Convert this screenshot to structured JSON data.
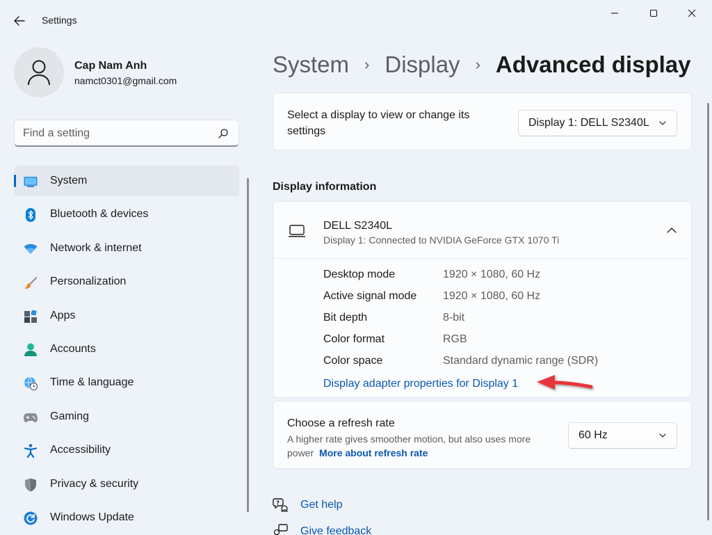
{
  "window": {
    "title": "Settings"
  },
  "profile": {
    "name": "Cap Nam Anh",
    "email": "namct0301@gmail.com"
  },
  "search": {
    "placeholder": "Find a setting",
    "value": ""
  },
  "sidebar": {
    "items": [
      {
        "label": "System",
        "icon": "system-icon",
        "active": true
      },
      {
        "label": "Bluetooth & devices",
        "icon": "bluetooth-icon"
      },
      {
        "label": "Network & internet",
        "icon": "wifi-icon"
      },
      {
        "label": "Personalization",
        "icon": "brush-icon"
      },
      {
        "label": "Apps",
        "icon": "apps-icon"
      },
      {
        "label": "Accounts",
        "icon": "accounts-icon"
      },
      {
        "label": "Time & language",
        "icon": "globe-clock-icon"
      },
      {
        "label": "Gaming",
        "icon": "gamepad-icon"
      },
      {
        "label": "Accessibility",
        "icon": "accessibility-icon"
      },
      {
        "label": "Privacy & security",
        "icon": "shield-icon"
      },
      {
        "label": "Windows Update",
        "icon": "update-icon"
      }
    ]
  },
  "breadcrumb": {
    "items": [
      "System",
      "Display"
    ],
    "current": "Advanced display",
    "separator": "›"
  },
  "display_select": {
    "label": "Select a display to view or change its settings",
    "selected": "Display 1: DELL S2340L"
  },
  "display_info": {
    "section_title": "Display information",
    "device_name": "DELL S2340L",
    "device_sub": "Display 1: Connected to NVIDIA GeForce GTX 1070 Ti",
    "rows": [
      {
        "key": "Desktop mode",
        "value": "1920 × 1080, 60 Hz"
      },
      {
        "key": "Active signal mode",
        "value": "1920 × 1080, 60 Hz"
      },
      {
        "key": "Bit depth",
        "value": "8-bit"
      },
      {
        "key": "Color format",
        "value": "RGB"
      },
      {
        "key": "Color space",
        "value": "Standard dynamic range (SDR)"
      }
    ],
    "adapter_link": "Display adapter properties for Display 1"
  },
  "refresh_rate": {
    "title": "Choose a refresh rate",
    "description": "A higher rate gives smoother motion, but also uses more power",
    "link": "More about refresh rate",
    "selected": "60 Hz"
  },
  "help": {
    "get_help": "Get help",
    "give_feedback": "Give feedback"
  },
  "colors": {
    "accent": "#0067c0",
    "link": "#0a57b0",
    "background": "#eef3f9",
    "card": "#fbfcfd",
    "annotation_arrow": "#e8343a"
  }
}
